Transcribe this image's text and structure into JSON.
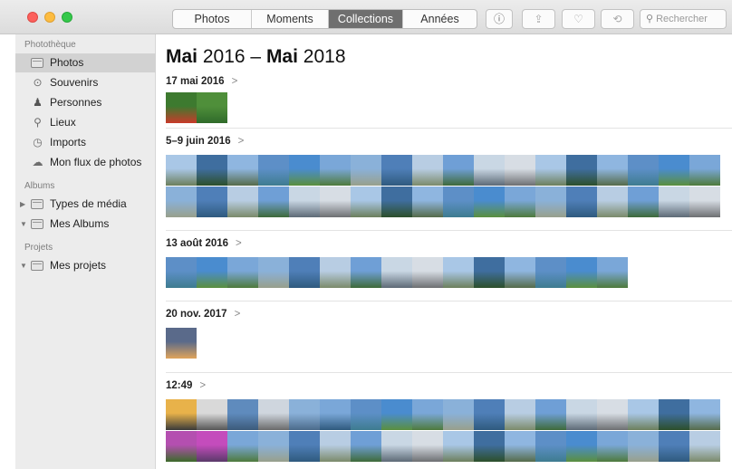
{
  "toolbar": {
    "tabs": [
      {
        "label": "Photos",
        "active": false
      },
      {
        "label": "Moments",
        "active": false
      },
      {
        "label": "Collections",
        "active": true
      },
      {
        "label": "Années",
        "active": false
      }
    ],
    "info_icon": "info-icon",
    "share_icon": "share-icon",
    "favorite_icon": "heart-icon",
    "rotate_icon": "rotate-icon",
    "search_placeholder": "Rechercher"
  },
  "sidebar": {
    "library_header": "Photothèque",
    "library_items": [
      {
        "label": "Photos",
        "icon": "photos-icon",
        "selected": true
      },
      {
        "label": "Souvenirs",
        "icon": "memories-icon",
        "selected": false
      },
      {
        "label": "Personnes",
        "icon": "people-icon",
        "selected": false
      },
      {
        "label": "Lieux",
        "icon": "pin-icon",
        "selected": false
      },
      {
        "label": "Imports",
        "icon": "clock-icon",
        "selected": false
      },
      {
        "label": "Mon flux de photos",
        "icon": "cloud-icon",
        "selected": false
      }
    ],
    "albums_header": "Albums",
    "album_items": [
      {
        "label": "Types de média",
        "expanded": false
      },
      {
        "label": "Mes Albums",
        "expanded": true
      }
    ],
    "projects_header": "Projets",
    "project_items": [
      {
        "label": "Mes projets",
        "expanded": true
      }
    ]
  },
  "main": {
    "heading_bold_1": "Mai",
    "heading_light_1": "2016 – ",
    "heading_bold_2": "Mai",
    "heading_light_2": "2018",
    "moments": [
      {
        "title": "17 mai 2016",
        "count": 2
      },
      {
        "title": "5–9 juin 2016",
        "count": 36
      },
      {
        "title": "13 août 2016",
        "count": 15
      },
      {
        "title": "20 nov. 2017",
        "count": 1
      },
      {
        "title": "12:49",
        "count": 36
      }
    ],
    "chevron": ">"
  },
  "colors": {
    "sidebar_bg": "#ececec",
    "selected_bg": "#d2d2d2",
    "active_tab": "#6f6f6f"
  }
}
